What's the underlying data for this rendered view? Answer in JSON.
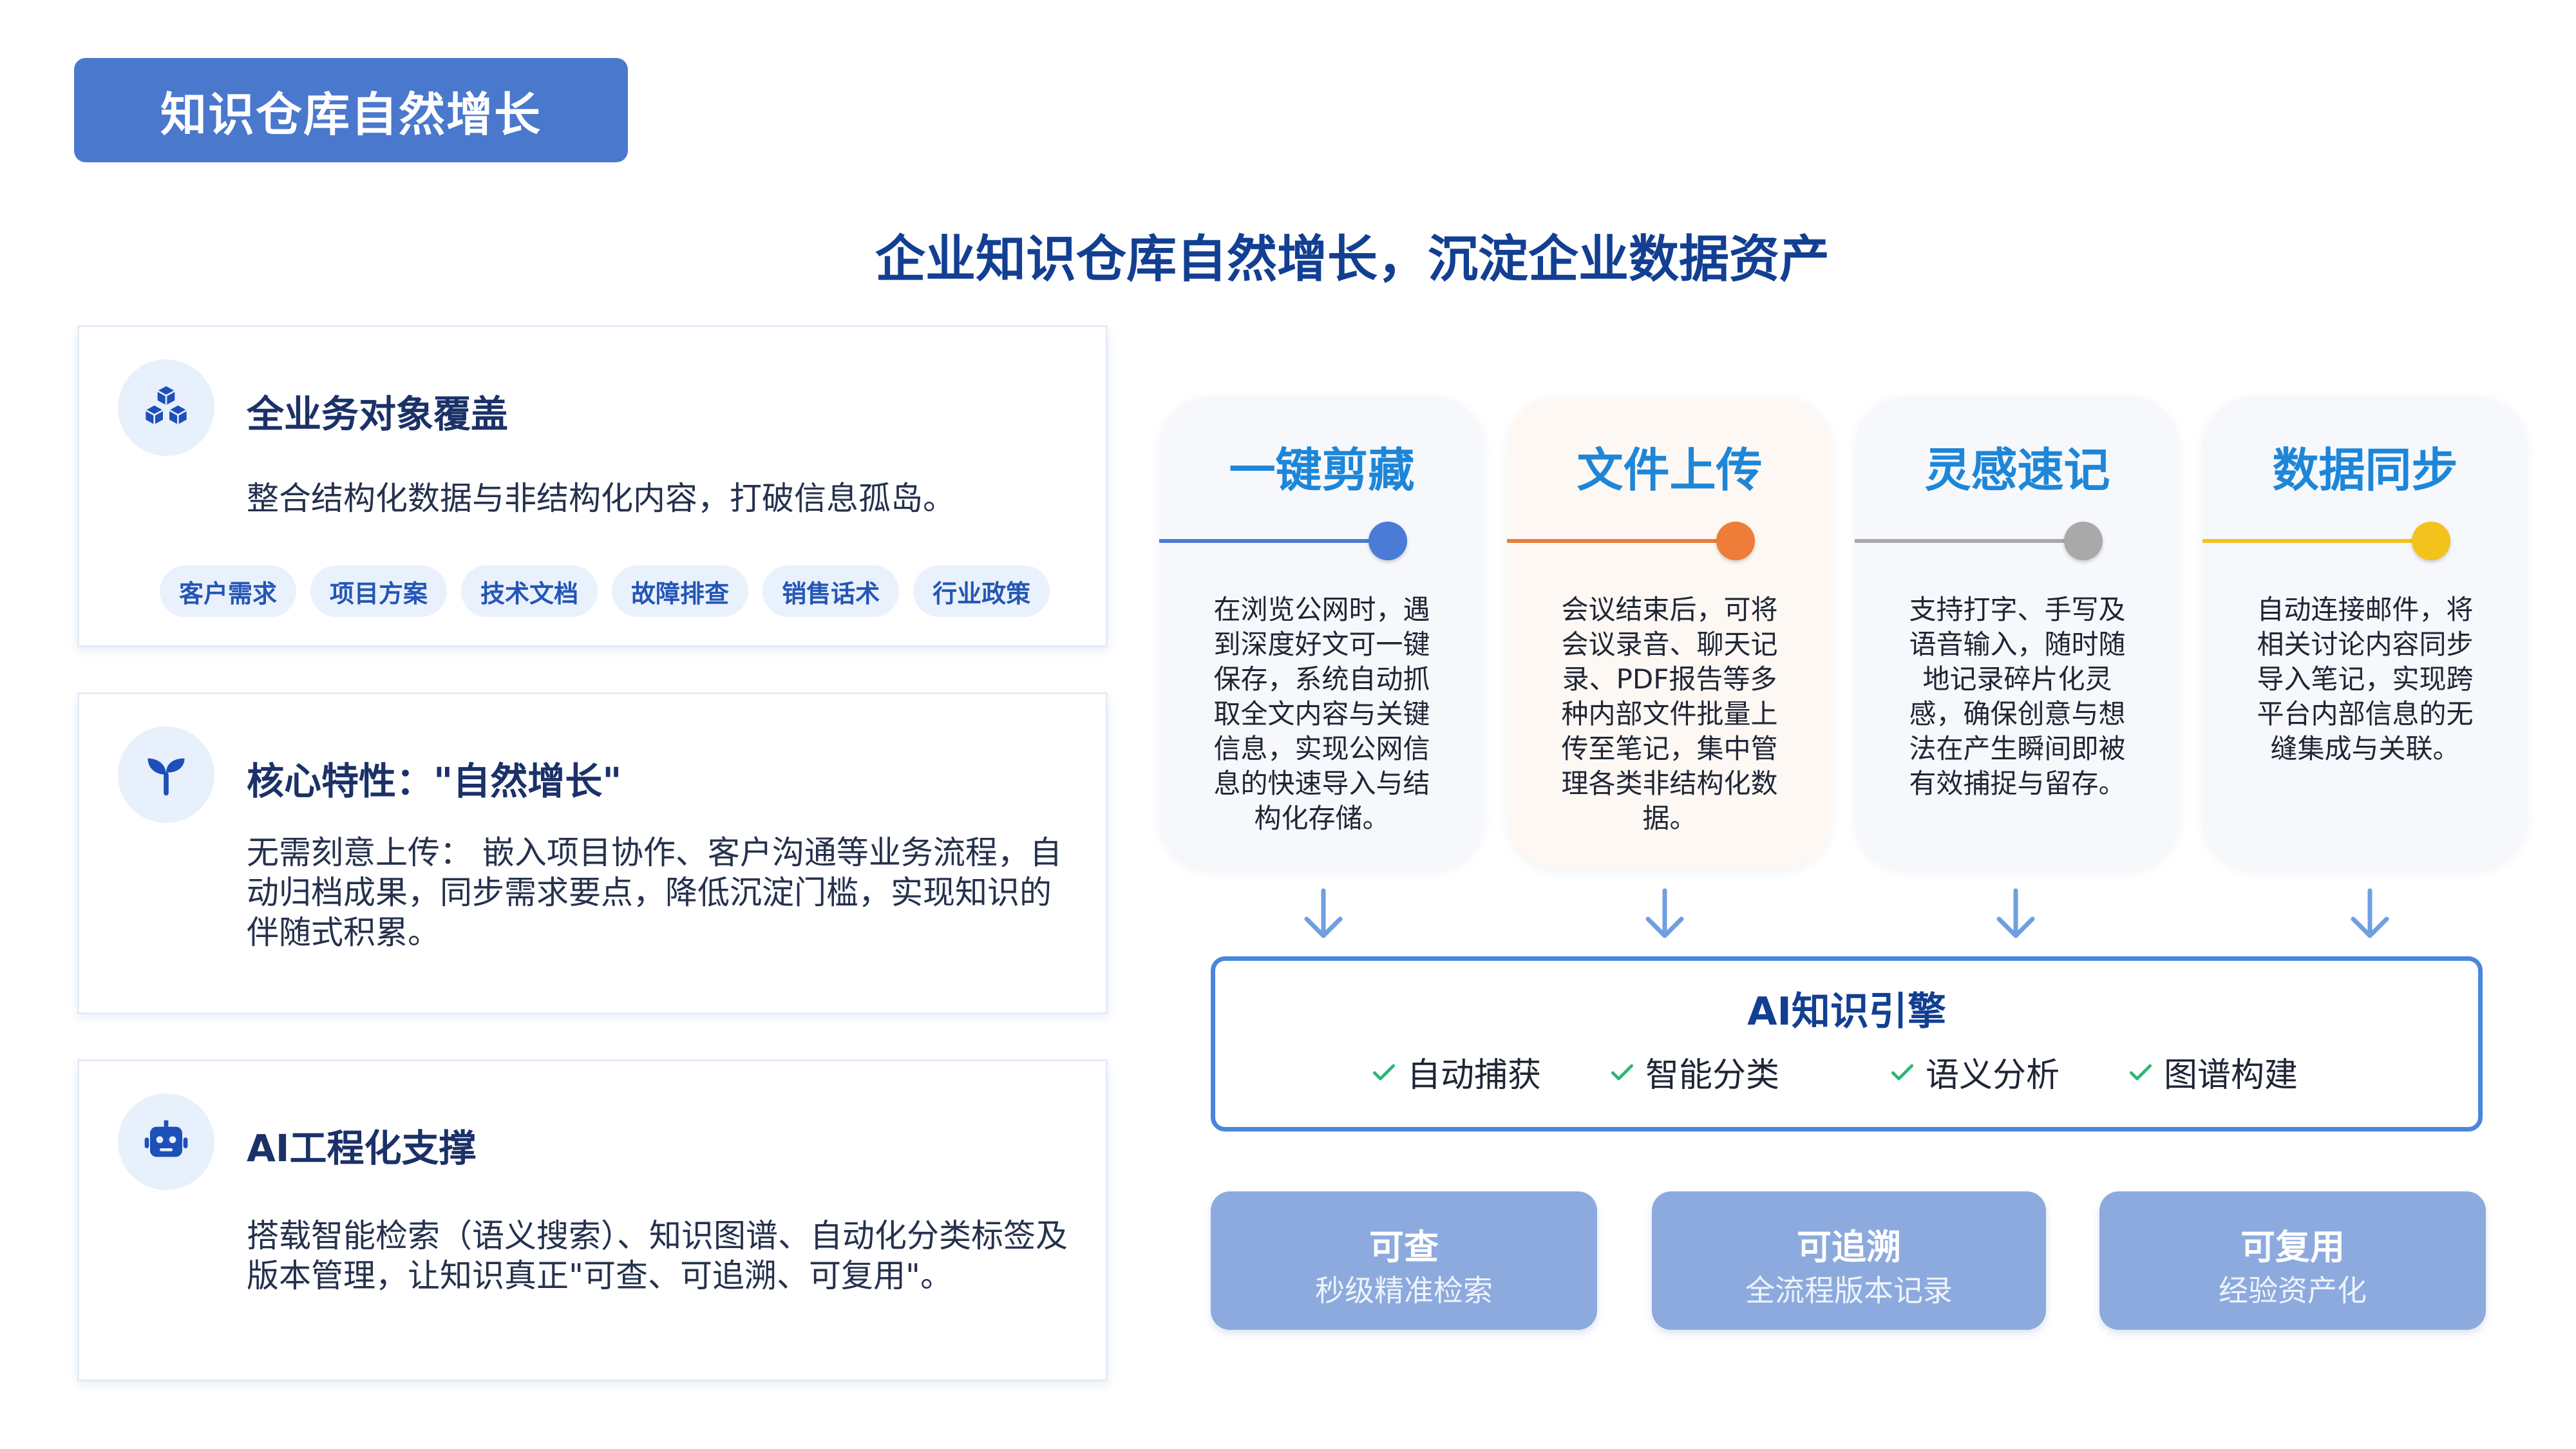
{
  "header": {
    "badge": "知识仓库自然增长",
    "headline": "企业知识仓库自然增长，沉淀企业数据资产"
  },
  "left_cards": [
    {
      "icon": "cubes-icon",
      "title": "全业务对象覆盖",
      "desc": "整合结构化数据与非结构化内容，打破信息孤岛。",
      "tags": [
        "客户需求",
        "项目方案",
        "技术文档",
        "故障排查",
        "销售话术",
        "行业政策"
      ]
    },
    {
      "icon": "sprout-icon",
      "title": "核心特性：\"自然增长\"",
      "desc": "无需刻意上传： 嵌入项目协作、客户沟通等业务流程，自动归档成果，同步需求要点，降低沉淀门槛，实现知识的伴随式积累。"
    },
    {
      "icon": "robot-icon",
      "title": "AI工程化支撑",
      "desc": "搭载智能检索（语义搜索）、知识图谱、自动化分类标签及版本管理，让知识真正\"可查、可追溯、可复用\"。"
    }
  ],
  "stages": [
    {
      "title": "一键剪藏",
      "color": "#4a7bd6",
      "desc": "在浏览公网时，遇到深度好文可一键保存，系统自动抓取全文内容与关键信息，实现公网信息的快速导入与结构化存储。"
    },
    {
      "title": "文件上传",
      "color": "#ee7d3a",
      "desc": "会议结束后，可将会议录音、聊天记录、PDF报告等多种内部文件批量上传至笔记，集中管理各类非结构化数据。"
    },
    {
      "title": "灵感速记",
      "color": "#a9a9a9",
      "desc": "支持打字、手写及语音输入，随时随地记录碎片化灵感，确保创意与想法在产生瞬间即被有效捕捉与留存。"
    },
    {
      "title": "数据同步",
      "color": "#f3c21c",
      "desc": "自动连接邮件，将相关讨论内容同步导入笔记，实现跨平台内部信息的无缝集成与关联。"
    }
  ],
  "engine": {
    "title": "AI知识引擎",
    "features": [
      "自动捕获",
      "智能分类",
      "语义分析",
      "图谱构建"
    ]
  },
  "values": [
    {
      "title": "可查",
      "sub": "秒级精准检索"
    },
    {
      "title": "可追溯",
      "sub": "全流程版本记录"
    },
    {
      "title": "可复用",
      "sub": "经验资产化"
    }
  ],
  "colors": {
    "primary": "#4a78cc",
    "headline": "#123f92",
    "stage_title": "#1e86d8",
    "value_box": "#8caadd"
  }
}
